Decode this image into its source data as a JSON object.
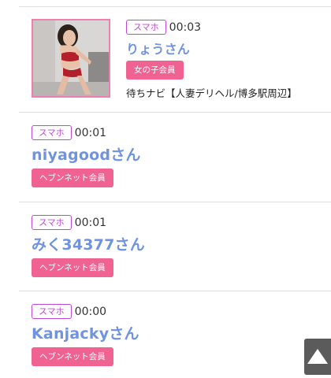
{
  "entries": [
    {
      "device": "スマホ",
      "time": "00:03",
      "name": "りょうさん",
      "member": "女の子会員",
      "shop": "待ちナビ【人妻デリヘル/博多駅周辺】"
    },
    {
      "device": "スマホ",
      "time": "00:01",
      "name": "niyagoodさん",
      "member": "ヘブンネット会員"
    },
    {
      "device": "スマホ",
      "time": "00:01",
      "name": "みく34377さん",
      "member": "ヘブンネット会員"
    },
    {
      "device": "スマホ",
      "time": "00:00",
      "name": "Kanjackyさん",
      "member": "ヘブンネット会員"
    }
  ],
  "colors": {
    "device_badge": "#c048d8",
    "name": "#6f93e0",
    "member_badge": "#f06292",
    "photo_border": "#ef7fb0",
    "scroll_button": "#5b5b5b"
  },
  "icons": {
    "scroll_top": "triangle-up-icon"
  }
}
